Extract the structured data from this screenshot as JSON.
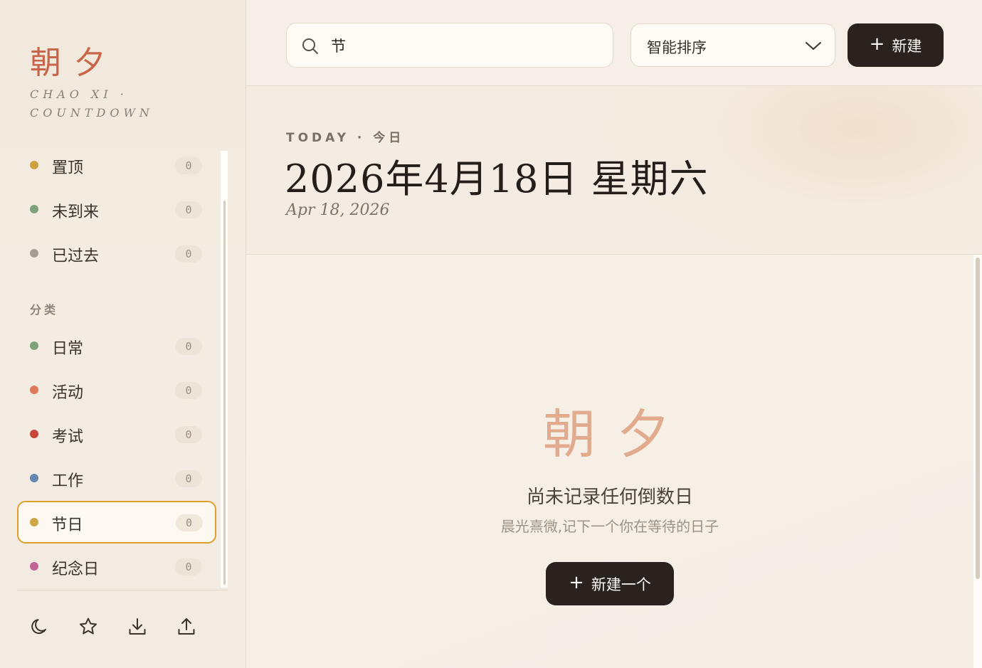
{
  "sidebar": {
    "logo": "朝夕",
    "logo_sub": "CHAO XI · COUNTDOWN",
    "status_items": [
      {
        "label": "置顶",
        "count": "0",
        "color": "#d0a03e"
      },
      {
        "label": "未到来",
        "count": "0",
        "color": "#7fa379"
      },
      {
        "label": "已过去",
        "count": "0",
        "color": "#a89d94"
      }
    ],
    "category_title": "分类",
    "category_items": [
      {
        "label": "日常",
        "count": "0",
        "color": "#7fa379"
      },
      {
        "label": "活动",
        "count": "0",
        "color": "#e0785a"
      },
      {
        "label": "考试",
        "count": "0",
        "color": "#c8453a"
      },
      {
        "label": "工作",
        "count": "0",
        "color": "#6389b0"
      },
      {
        "label": "节日",
        "count": "0",
        "color": "#cfa646",
        "active": true
      },
      {
        "label": "纪念日",
        "count": "0",
        "color": "#c46496"
      }
    ],
    "tools": [
      "moon-icon",
      "star-icon",
      "download-icon",
      "upload-icon"
    ]
  },
  "toolbar": {
    "search_value": "节",
    "sort_label": "智能排序",
    "new_label": "新建"
  },
  "today": {
    "label": "TODAY · 今日",
    "date": "2026年4月18日 星期六",
    "date_en": "Apr 18, 2026"
  },
  "empty": {
    "logo": "朝夕",
    "title": "尚未记录任何倒数日",
    "subtitle": "晨光熹微,记下一个你在等待的日子",
    "button_label": "新建一个"
  },
  "colors": {
    "accent": "#c8664a",
    "active_border": "#dca02c",
    "dark_button": "#2a221e"
  }
}
